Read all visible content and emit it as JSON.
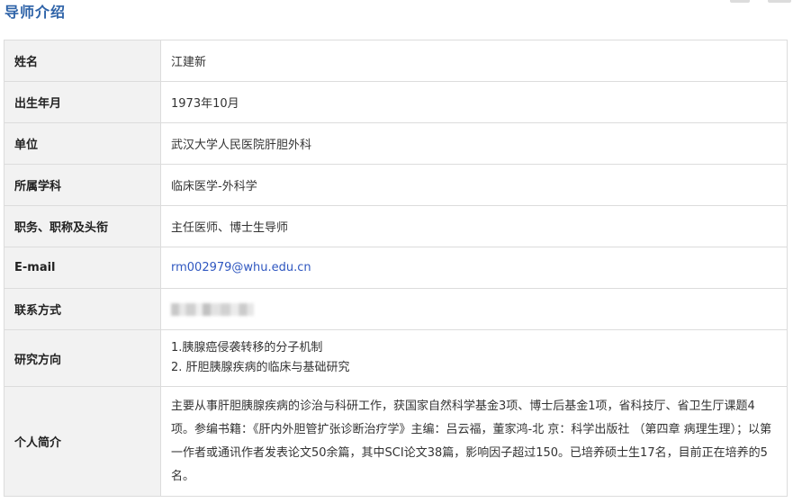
{
  "page": {
    "title": "导师介绍"
  },
  "rows": [
    {
      "label": "姓名",
      "value": "江建新"
    },
    {
      "label": "出生年月",
      "value": "1973年10月"
    },
    {
      "label": "单位",
      "value": "武汉大学人民医院肝胆外科"
    },
    {
      "label": "所属学科",
      "value": "临床医学-外科学"
    },
    {
      "label": "职务、职称及头衔",
      "value": "主任医师、博士生导师"
    },
    {
      "label": "E-mail",
      "value": "rm002979@whu.edu.cn"
    },
    {
      "label": "联系方式",
      "value": ""
    },
    {
      "label": "研究方向",
      "lines": [
        "1.胰腺癌侵袭转移的分子机制",
        "2. 肝胆胰腺疾病的临床与基础研究"
      ]
    },
    {
      "label": "个人简介",
      "value": "主要从事肝胆胰腺疾病的诊治与科研工作，获国家自然科学基金3项、博士后基金1项，省科技厅、省卫生厅课题4项。参编书籍：《肝内外胆管扩张诊断治疗学》主编：吕云福，董家鸿-北 京：科学出版社 （第四章 病理生理）；以第一作者或通讯作者发表论文50余篇，其中SCI论文38篇，影响因子超过150。已培养硕士生17名，目前正在培养的5名。"
    }
  ]
}
